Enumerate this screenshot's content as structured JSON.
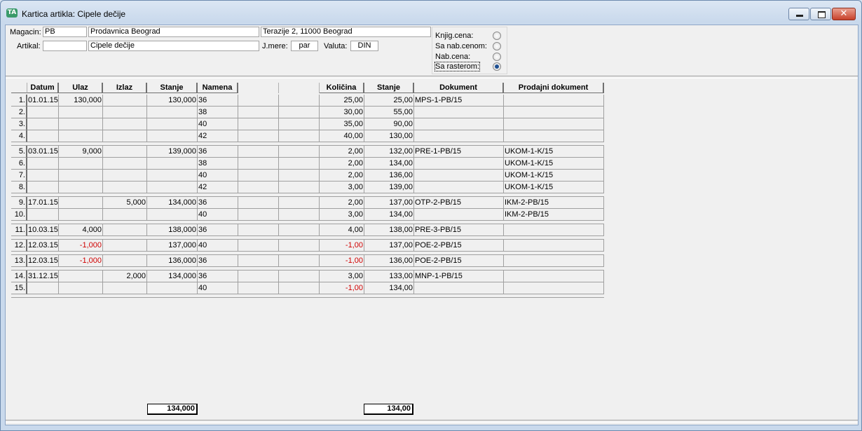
{
  "window": {
    "title": "Kartica artikla: Cipele dečije",
    "icon": "app-icon",
    "close_glyph": "✕"
  },
  "header": {
    "magacin_label": "Magacin:",
    "magacin_code": "PB",
    "magacin_name": "Prodavnica Beograd",
    "magacin_address": "Terazije 2, 11000 Beograd",
    "artikal_label": "Artikal:",
    "artikal_code": "",
    "artikal_name": "Cipele dečije",
    "jmere_label": "J.mere:",
    "jmere_value": "par",
    "valuta_label": "Valuta:",
    "valuta_value": "DIN"
  },
  "price_options": [
    {
      "label": "Knjig.cena:",
      "selected": false
    },
    {
      "label": "Sa nab.cenom:",
      "selected": false
    },
    {
      "label": "Nab.cena:",
      "selected": false
    },
    {
      "label": "Sa rasterom:",
      "selected": true
    }
  ],
  "table": {
    "columns": [
      "Datum",
      "Ulaz",
      "Izlaz",
      "Stanje",
      "Namena",
      "",
      "",
      "Količina",
      "Stanje",
      "Dokument",
      "Prodajni dokument"
    ],
    "groups": [
      {
        "rows": [
          {
            "n": "1.",
            "datum": "01.01.15",
            "ulaz": "130,000",
            "izlaz": "",
            "stanje": "130,000",
            "namena": "36",
            "kol": "25,00",
            "st": "25,00",
            "dok": "MPS-1-PB/15",
            "pdok": ""
          },
          {
            "n": "2.",
            "datum": "",
            "ulaz": "",
            "izlaz": "",
            "stanje": "",
            "namena": "38",
            "kol": "30,00",
            "st": "55,00",
            "dok": "",
            "pdok": ""
          },
          {
            "n": "3.",
            "datum": "",
            "ulaz": "",
            "izlaz": "",
            "stanje": "",
            "namena": "40",
            "kol": "35,00",
            "st": "90,00",
            "dok": "",
            "pdok": ""
          },
          {
            "n": "4.",
            "datum": "",
            "ulaz": "",
            "izlaz": "",
            "stanje": "",
            "namena": "42",
            "kol": "40,00",
            "st": "130,00",
            "dok": "",
            "pdok": ""
          }
        ]
      },
      {
        "rows": [
          {
            "n": "5.",
            "datum": "03.01.15",
            "ulaz": "9,000",
            "izlaz": "",
            "stanje": "139,000",
            "namena": "36",
            "kol": "2,00",
            "st": "132,00",
            "dok": "PRE-1-PB/15",
            "pdok": "UKOM-1-K/15"
          },
          {
            "n": "6.",
            "datum": "",
            "ulaz": "",
            "izlaz": "",
            "stanje": "",
            "namena": "38",
            "kol": "2,00",
            "st": "134,00",
            "dok": "",
            "pdok": "UKOM-1-K/15"
          },
          {
            "n": "7.",
            "datum": "",
            "ulaz": "",
            "izlaz": "",
            "stanje": "",
            "namena": "40",
            "kol": "2,00",
            "st": "136,00",
            "dok": "",
            "pdok": "UKOM-1-K/15"
          },
          {
            "n": "8.",
            "datum": "",
            "ulaz": "",
            "izlaz": "",
            "stanje": "",
            "namena": "42",
            "kol": "3,00",
            "st": "139,00",
            "dok": "",
            "pdok": "UKOM-1-K/15"
          }
        ]
      },
      {
        "rows": [
          {
            "n": "9.",
            "datum": "17.01.15",
            "ulaz": "",
            "izlaz": "5,000",
            "stanje": "134,000",
            "namena": "36",
            "kol": "2,00",
            "st": "137,00",
            "dok": "OTP-2-PB/15",
            "pdok": "IKM-2-PB/15"
          },
          {
            "n": "10.",
            "datum": "",
            "ulaz": "",
            "izlaz": "",
            "stanje": "",
            "namena": "40",
            "kol": "3,00",
            "st": "134,00",
            "dok": "",
            "pdok": "IKM-2-PB/15"
          }
        ]
      },
      {
        "rows": [
          {
            "n": "11.",
            "datum": "10.03.15",
            "ulaz": "4,000",
            "izlaz": "",
            "stanje": "138,000",
            "namena": "36",
            "kol": "4,00",
            "st": "138,00",
            "dok": "PRE-3-PB/15",
            "pdok": ""
          }
        ]
      },
      {
        "rows": [
          {
            "n": "12.",
            "datum": "12.03.15",
            "ulaz": "-1,000",
            "izlaz": "",
            "stanje": "137,000",
            "namena": "40",
            "kol": "-1,00",
            "st": "137,00",
            "dok": "POE-2-PB/15",
            "pdok": ""
          }
        ]
      },
      {
        "rows": [
          {
            "n": "13.",
            "datum": "12.03.15",
            "ulaz": "-1,000",
            "izlaz": "",
            "stanje": "136,000",
            "namena": "36",
            "kol": "-1,00",
            "st": "136,00",
            "dok": "POE-2-PB/15",
            "pdok": ""
          }
        ]
      },
      {
        "rows": [
          {
            "n": "14.",
            "datum": "31.12.15",
            "ulaz": "",
            "izlaz": "2,000",
            "stanje": "134,000",
            "namena": "36",
            "kol": "3,00",
            "st": "133,00",
            "dok": "MNP-1-PB/15",
            "pdok": ""
          },
          {
            "n": "15.",
            "datum": "",
            "ulaz": "",
            "izlaz": "",
            "stanje": "",
            "namena": "40",
            "kol": "-1,00",
            "st": "134,00",
            "dok": "",
            "pdok": ""
          }
        ]
      }
    ]
  },
  "totals": {
    "stanje": "134,000",
    "kolicina_stanje": "134,00"
  },
  "colors": {
    "negative": "#d00000",
    "title_bg": "#c9d9ec",
    "close": "#c8412b"
  }
}
